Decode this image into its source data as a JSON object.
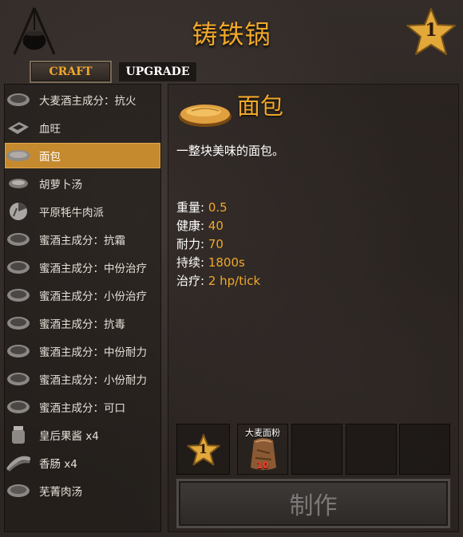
{
  "header": {
    "title": "铸铁锅",
    "station_level": "1",
    "tabs": [
      {
        "label": "CRAFT",
        "active": true
      },
      {
        "label": "UPGRADE",
        "active": false
      }
    ]
  },
  "recipes": [
    {
      "label": "大麦酒主成分：抗火",
      "icon": "bowl-icon"
    },
    {
      "label": "血旺",
      "icon": "blood-pudding-icon"
    },
    {
      "label": "面包",
      "icon": "bread-icon",
      "selected": true
    },
    {
      "label": "胡萝卜汤",
      "icon": "soup-icon"
    },
    {
      "label": "平原牦牛肉派",
      "icon": "pie-icon"
    },
    {
      "label": "蜜酒主成分：抗霜",
      "icon": "bowl-icon"
    },
    {
      "label": "蜜酒主成分：中份治疗",
      "icon": "bowl-icon"
    },
    {
      "label": "蜜酒主成分：小份治疗",
      "icon": "bowl-icon"
    },
    {
      "label": "蜜酒主成分：抗毒",
      "icon": "bowl-icon"
    },
    {
      "label": "蜜酒主成分：中份耐力",
      "icon": "bowl-icon"
    },
    {
      "label": "蜜酒主成分：小份耐力",
      "icon": "bowl-icon"
    },
    {
      "label": "蜜酒主成分：可口",
      "icon": "bowl-icon"
    },
    {
      "label": "皇后果酱 x4",
      "icon": "jar-icon"
    },
    {
      "label": "香肠 x4",
      "icon": "sausage-icon"
    },
    {
      "label": "芜菁肉汤",
      "icon": "bowl-icon"
    }
  ],
  "detail": {
    "name": "面包",
    "description": "一整块美味的面包。",
    "stats": [
      {
        "label": "重量: ",
        "value": "0.5"
      },
      {
        "label": "健康: ",
        "value": "40"
      },
      {
        "label": "耐力: ",
        "value": "70"
      },
      {
        "label": "持续: ",
        "value": "1800s"
      },
      {
        "label": "治疗: ",
        "value": "2 hp/tick"
      }
    ]
  },
  "requirements": {
    "station_level": "1",
    "ingredients": [
      {
        "name": "大麦面粉",
        "amount": "10",
        "icon": "flour-sack-icon"
      }
    ]
  },
  "craft_button": {
    "label": "制作",
    "enabled": false
  },
  "colors": {
    "accent": "#f0a82a",
    "selected": "#c68a2e",
    "insufficient": "#ff3a2a"
  }
}
